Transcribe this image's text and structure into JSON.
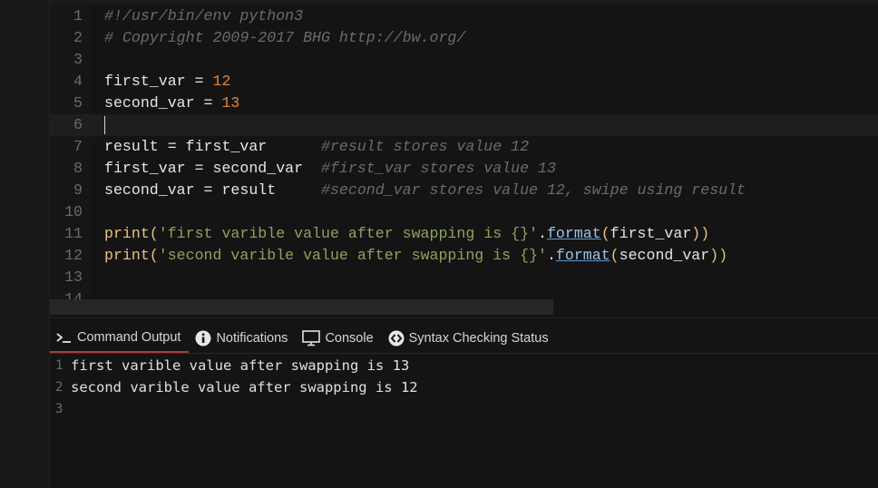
{
  "editor": {
    "lines": [
      {
        "n": "1",
        "parts": [
          {
            "t": "#!/usr/bin/env python3",
            "c": "cm"
          }
        ]
      },
      {
        "n": "2",
        "parts": [
          {
            "t": "# Copyright 2009-2017 BHG http://bw.org/",
            "c": "cm"
          }
        ]
      },
      {
        "n": "3",
        "parts": []
      },
      {
        "n": "4",
        "parts": [
          {
            "t": "first_var = ",
            "c": "var"
          },
          {
            "t": "12",
            "c": "num"
          }
        ]
      },
      {
        "n": "5",
        "parts": [
          {
            "t": "second_var = ",
            "c": "var"
          },
          {
            "t": "13",
            "c": "num"
          }
        ]
      },
      {
        "n": "6",
        "parts": [],
        "current": true
      },
      {
        "n": "7",
        "parts": [
          {
            "t": "result = first_var      ",
            "c": "var"
          },
          {
            "t": "#result stores value 12",
            "c": "cm"
          }
        ]
      },
      {
        "n": "8",
        "parts": [
          {
            "t": "first_var = second_var  ",
            "c": "var"
          },
          {
            "t": "#first_var stores value 13",
            "c": "cm"
          }
        ]
      },
      {
        "n": "9",
        "parts": [
          {
            "t": "second_var = result     ",
            "c": "var"
          },
          {
            "t": "#second_var stores value 12, swipe using result",
            "c": "cm"
          }
        ]
      },
      {
        "n": "10",
        "parts": []
      },
      {
        "n": "11",
        "parts": [
          {
            "t": "print(",
            "c": "kw"
          },
          {
            "t": "'first varible value after swapping is {}'",
            "c": "str"
          },
          {
            "t": ".",
            "c": "var"
          },
          {
            "t": "format",
            "c": "fn"
          },
          {
            "t": "(",
            "c": "kw"
          },
          {
            "t": "first_var",
            "c": "var"
          },
          {
            "t": "))",
            "c": "kw"
          }
        ]
      },
      {
        "n": "12",
        "parts": [
          {
            "t": "print(",
            "c": "kw"
          },
          {
            "t": "'second varible value after swapping is {}'",
            "c": "str"
          },
          {
            "t": ".",
            "c": "var"
          },
          {
            "t": "format",
            "c": "fn"
          },
          {
            "t": "(",
            "c": "kw"
          },
          {
            "t": "second_var",
            "c": "var"
          },
          {
            "t": "))",
            "c": "kw"
          }
        ]
      },
      {
        "n": "13",
        "parts": []
      },
      {
        "n": "14",
        "parts": []
      }
    ]
  },
  "panel": {
    "tabs": [
      {
        "label": "Command Output",
        "icon": "terminal-icon",
        "active": true
      },
      {
        "label": "Notifications",
        "icon": "info-icon"
      },
      {
        "label": "Console",
        "icon": "monitor-icon"
      },
      {
        "label": "Syntax Checking Status",
        "icon": "code-icon"
      }
    ],
    "output": [
      {
        "n": "1",
        "text": "first varible value after swapping is 13"
      },
      {
        "n": "2",
        "text": "second varible value after swapping is 12"
      },
      {
        "n": "3",
        "text": ""
      }
    ]
  }
}
